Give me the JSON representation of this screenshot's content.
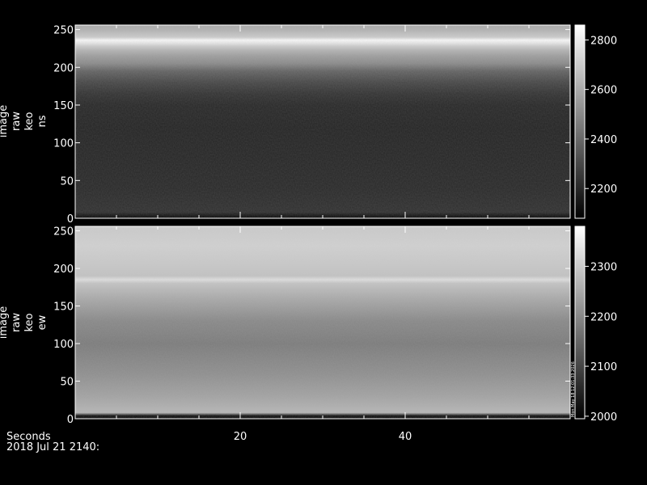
{
  "chart_data": [
    {
      "type": "heatmap",
      "panel": "top",
      "ylabel": [
        "image",
        "raw",
        "keo",
        "ns"
      ],
      "y_ticks": [
        0,
        50,
        100,
        150,
        200,
        250
      ],
      "ylim": [
        0,
        256
      ],
      "xlim": [
        0,
        60
      ],
      "colorbar": {
        "ticks": [
          2200,
          2400,
          2600,
          2800
        ],
        "range": [
          2080,
          2860
        ],
        "scale": "grayscale"
      },
      "row_profile": {
        "description_rows": [
          0,
          4,
          8,
          40,
          80,
          120,
          150,
          165,
          180,
          195,
          205,
          215,
          222,
          228,
          232,
          236,
          240,
          250,
          256
        ],
        "values": [
          2100,
          2150,
          2220,
          2200,
          2190,
          2185,
          2195,
          2230,
          2290,
          2380,
          2500,
          2560,
          2620,
          2700,
          2780,
          2840,
          2700,
          2620,
          2600
        ]
      }
    },
    {
      "type": "heatmap",
      "panel": "bottom",
      "ylabel": [
        "image",
        "raw",
        "keo",
        "ew"
      ],
      "y_ticks": [
        0,
        50,
        100,
        150,
        200,
        250
      ],
      "ylim": [
        0,
        256
      ],
      "xlim": [
        0,
        60
      ],
      "colorbar": {
        "ticks": [
          2000,
          2100,
          2200,
          2300
        ],
        "range": [
          1995,
          2380
        ],
        "scale": "grayscale"
      },
      "row_profile": {
        "description_rows": [
          0,
          4,
          8,
          30,
          60,
          100,
          130,
          160,
          180,
          185,
          190,
          210,
          230,
          256
        ],
        "values": [
          2010,
          2020,
          2270,
          2240,
          2210,
          2180,
          2200,
          2250,
          2290,
          2330,
          2290,
          2300,
          2310,
          2300
        ]
      }
    }
  ],
  "x_axis": {
    "ticks": [
      20,
      40
    ],
    "label": "Seconds",
    "date": "2018 Jul 21 2140:"
  },
  "timestamp_note": "Mon May 18 12:01:33 2026",
  "colors": {
    "background": "#000000",
    "foreground": "#ffffff"
  }
}
